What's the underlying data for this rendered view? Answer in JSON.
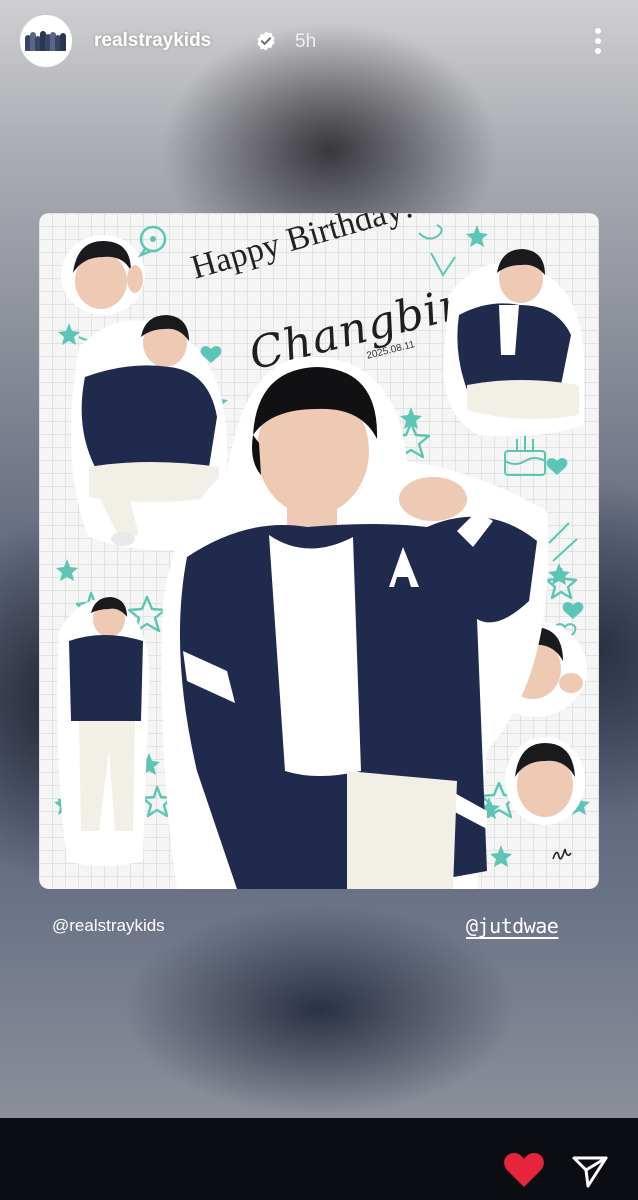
{
  "story": {
    "username": "realstraykids",
    "verified": true,
    "time_ago": "5h",
    "more_icon": "more-vertical-icon",
    "avatar_icon": "group-avatar"
  },
  "card": {
    "title_line1": "Happy Birthday!",
    "title_line2": "Changbin",
    "date": "2025.08.11"
  },
  "mentions": {
    "left": "@realstraykids",
    "right": "@jutdwae"
  },
  "actions": {
    "like_icon": "heart-icon",
    "like_color": "#e8243c",
    "share_icon": "send-icon"
  },
  "colors": {
    "accent_mint": "#5cc6b6",
    "jacket_navy": "#1f2a4d"
  }
}
